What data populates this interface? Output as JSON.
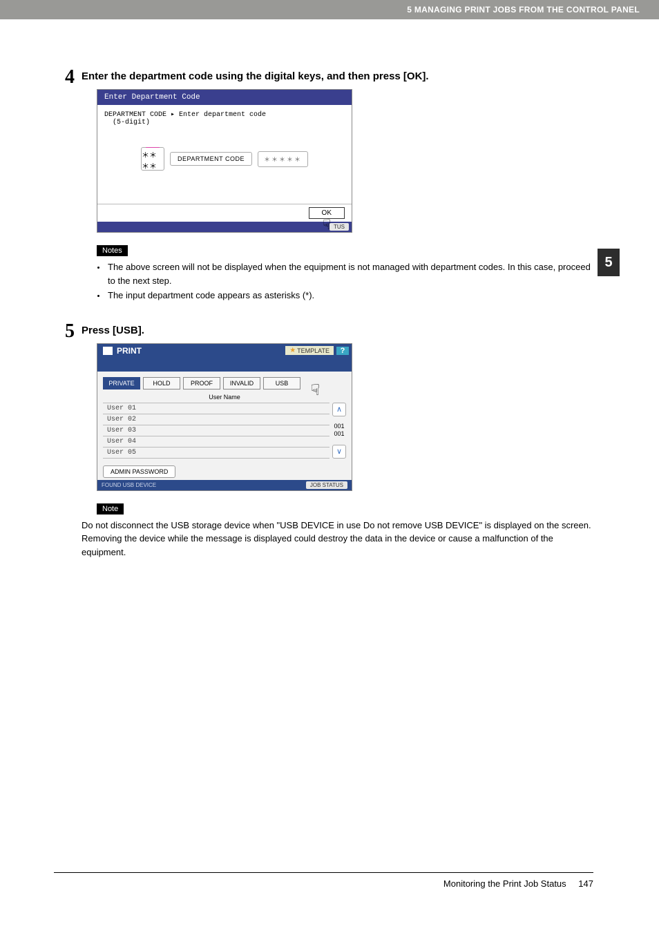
{
  "header": {
    "running": "5 MANAGING PRINT JOBS FROM THE CONTROL PANEL"
  },
  "side_tab": "5",
  "step4": {
    "num": "4",
    "title": "Enter the department code using the digital keys, and then press [OK].",
    "screen": {
      "title": "Enter Department Code",
      "instruction_line1": "DEPARTMENT CODE ▸ Enter department code",
      "instruction_line2": "(5-digit)",
      "card_asterisks": "＊＊＊＊",
      "field_label": "DEPARTMENT CODE",
      "field_value": "＊＊＊＊＊",
      "ok": "OK",
      "status_btn": "TUS"
    },
    "notes_label": "Notes",
    "notes": [
      "The above screen will not be displayed when the equipment is not managed with department codes. In this case, proceed to the next step.",
      "The input department code appears as asterisks (*)."
    ]
  },
  "step5": {
    "num": "5",
    "title": "Press [USB].",
    "screen": {
      "head_title": "PRINT",
      "template": "TEMPLATE",
      "help": "?",
      "tabs": [
        "PRIVATE",
        "HOLD",
        "PROOF",
        "INVALID",
        "USB"
      ],
      "column_label": "User Name",
      "users": [
        "User 01",
        "User 02",
        "User 03",
        "User 04",
        "User 05"
      ],
      "scroll_top": "001",
      "scroll_bottom": "001",
      "admin_pw": "ADMIN PASSWORD",
      "status_left": "FOUND USB DEVICE",
      "status_right": "JOB STATUS"
    },
    "note_label": "Note",
    "note_text": "Do not disconnect the USB storage device when \"USB DEVICE in use Do not remove USB DEVICE\" is displayed on the screen. Removing the device while the message is displayed could destroy the data in the device or cause a malfunction of the equipment."
  },
  "footer": {
    "title": "Monitoring the Print Job Status",
    "page": "147"
  }
}
